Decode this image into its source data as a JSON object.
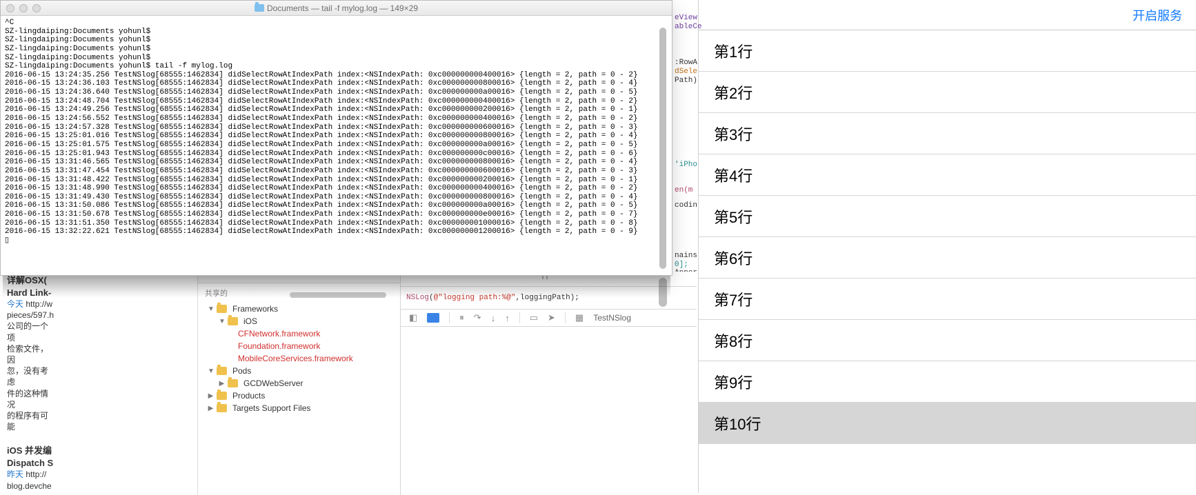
{
  "terminal": {
    "title": "Documents — tail -f mylog.log — 149×29",
    "lines": [
      "^C",
      "SZ-lingdaiping:Documents yohunl$",
      "SZ-lingdaiping:Documents yohunl$",
      "SZ-lingdaiping:Documents yohunl$",
      "SZ-lingdaiping:Documents yohunl$",
      "SZ-lingdaiping:Documents yohunl$ tail -f mylog.log",
      "2016-06-15 13:24:35.256 TestNSlog[68555:1462834] didSelectRowAtIndexPath index:<NSIndexPath: 0xc000000000400016> {length = 2, path = 0 - 2}",
      "2016-06-15 13:24:36.103 TestNSlog[68555:1462834] didSelectRowAtIndexPath index:<NSIndexPath: 0xc000000000800016> {length = 2, path = 0 - 4}",
      "2016-06-15 13:24:36.640 TestNSlog[68555:1462834] didSelectRowAtIndexPath index:<NSIndexPath: 0xc000000000a00016> {length = 2, path = 0 - 5}",
      "2016-06-15 13:24:48.704 TestNSlog[68555:1462834] didSelectRowAtIndexPath index:<NSIndexPath: 0xc000000000400016> {length = 2, path = 0 - 2}",
      "2016-06-15 13:24:49.256 TestNSlog[68555:1462834] didSelectRowAtIndexPath index:<NSIndexPath: 0xc000000000200016> {length = 2, path = 0 - 1}",
      "2016-06-15 13:24:56.552 TestNSlog[68555:1462834] didSelectRowAtIndexPath index:<NSIndexPath: 0xc000000000400016> {length = 2, path = 0 - 2}",
      "2016-06-15 13:24:57.328 TestNSlog[68555:1462834] didSelectRowAtIndexPath index:<NSIndexPath: 0xc000000000600016> {length = 2, path = 0 - 3}",
      "2016-06-15 13:25:01.016 TestNSlog[68555:1462834] didSelectRowAtIndexPath index:<NSIndexPath: 0xc000000000800016> {length = 2, path = 0 - 4}",
      "2016-06-15 13:25:01.575 TestNSlog[68555:1462834] didSelectRowAtIndexPath index:<NSIndexPath: 0xc000000000a00016> {length = 2, path = 0 - 5}",
      "2016-06-15 13:25:01.943 TestNSlog[68555:1462834] didSelectRowAtIndexPath index:<NSIndexPath: 0xc000000000c00016> {length = 2, path = 0 - 6}",
      "2016-06-15 13:31:46.565 TestNSlog[68555:1462834] didSelectRowAtIndexPath index:<NSIndexPath: 0xc000000000800016> {length = 2, path = 0 - 4}",
      "2016-06-15 13:31:47.454 TestNSlog[68555:1462834] didSelectRowAtIndexPath index:<NSIndexPath: 0xc000000000600016> {length = 2, path = 0 - 3}",
      "2016-06-15 13:31:48.422 TestNSlog[68555:1462834] didSelectRowAtIndexPath index:<NSIndexPath: 0xc000000000200016> {length = 2, path = 0 - 1}",
      "2016-06-15 13:31:48.990 TestNSlog[68555:1462834] didSelectRowAtIndexPath index:<NSIndexPath: 0xc000000000400016> {length = 2, path = 0 - 2}",
      "2016-06-15 13:31:49.430 TestNSlog[68555:1462834] didSelectRowAtIndexPath index:<NSIndexPath: 0xc000000000800016> {length = 2, path = 0 - 4}",
      "2016-06-15 13:31:50.086 TestNSlog[68555:1462834] didSelectRowAtIndexPath index:<NSIndexPath: 0xc000000000a00016> {length = 2, path = 0 - 5}",
      "2016-06-15 13:31:50.678 TestNSlog[68555:1462834] didSelectRowAtIndexPath index:<NSIndexPath: 0xc000000000e00016> {length = 2, path = 0 - 7}",
      "2016-06-15 13:31:51.350 TestNSlog[68555:1462834] didSelectRowAtIndexPath index:<NSIndexPath: 0xc000000001000016> {length = 2, path = 0 - 8}",
      "2016-06-15 13:32:22.621 TestNSlog[68555:1462834] didSelectRowAtIndexPath index:<NSIndexPath: 0xc000000001200016> {length = 2, path = 0 - 9}",
      "▯"
    ]
  },
  "frag_right": {
    "l1": "eView",
    "l2": "ableCe",
    "l3": ":RowA",
    "l4": "dSele",
    "l5": "Path)",
    "l6": "'iPho",
    "l7": "en(m",
    "l8": "codin",
    "l9": "nains",
    "l10": "0];",
    "l11": "Apper"
  },
  "finder": {
    "shared_label": "共享的",
    "items": {
      "frameworks": "Frameworks",
      "ios": "iOS",
      "cfnetwork": "CFNetwork.framework",
      "foundation": "Foundation.framework",
      "mobilecore": "MobileCoreServices.framework",
      "pods": "Pods",
      "gcdweb": "GCDWebServer",
      "products": "Products",
      "targets": "Targets Support Files"
    },
    "q": "?"
  },
  "left_blog": {
    "t1": "详解OSX(",
    "t2": "Hard Link-",
    "today": "今天",
    "u1": "http://w",
    "p1": "pieces/597.h",
    "p2": "公司的一个项",
    "p3": "检索文件，因",
    "p4": "忽，没有考虑",
    "p5": "件的这种情况",
    "p6": "的程序有可能",
    "t3": "iOS 并发编",
    "t4": "Dispatch S",
    "yest": "昨天",
    "u2": "http://",
    "p7": "blog.devche"
  },
  "code": {
    "line": "NSLog(@\"logging path:%@\",loggingPath);",
    "crumb": "TestNSlog"
  },
  "sim": {
    "top_link": "开启服务",
    "rows": [
      "第1行",
      "第2行",
      "第3行",
      "第4行",
      "第5行",
      "第6行",
      "第7行",
      "第8行",
      "第9行",
      "第10行"
    ],
    "selected": 9
  }
}
